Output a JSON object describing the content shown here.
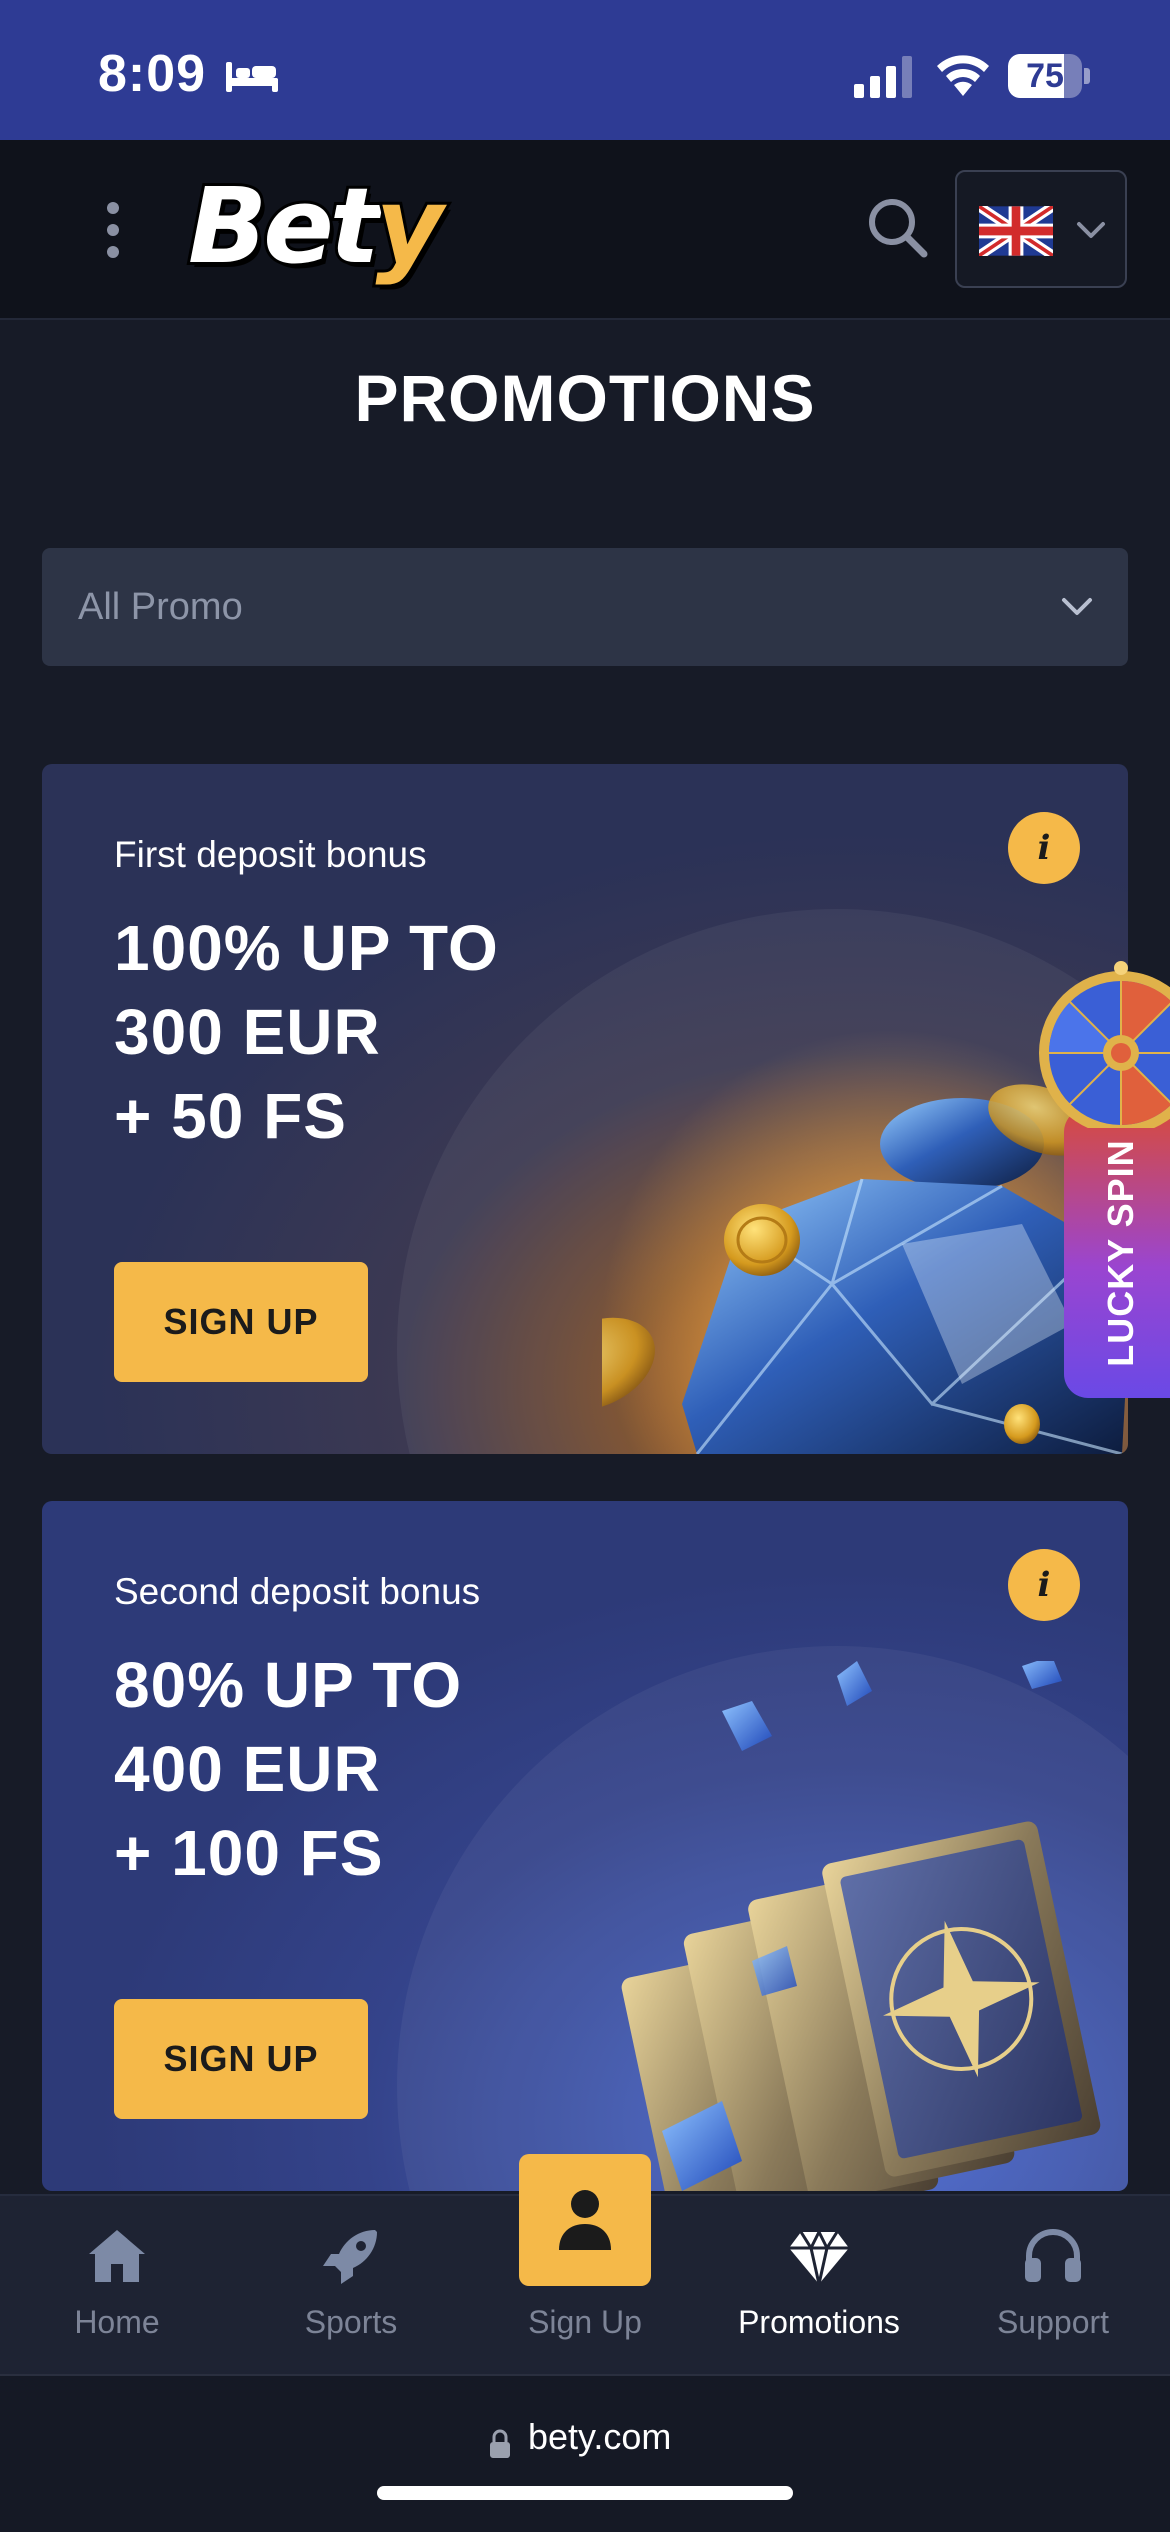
{
  "status_bar": {
    "time": "8:09",
    "battery": "75",
    "battery_level": 0.75
  },
  "header": {
    "logo": {
      "main": "Bet",
      "accent": "y"
    },
    "icons": [
      "menu-dots-icon",
      "search-icon",
      "uk-flag-icon",
      "chevron-down-icon"
    ]
  },
  "page": {
    "title": "PROMOTIONS"
  },
  "filter": {
    "selected": "All Promo"
  },
  "promos": [
    {
      "subtitle": "First deposit bonus",
      "headline": "100% UP TO\n300 EUR\n+ 50 FS",
      "info": "i",
      "cta": "SIGN UP"
    },
    {
      "subtitle": "Second deposit bonus",
      "headline": "80% UP TO\n400 EUR\n+ 100 FS",
      "info": "i",
      "cta": "SIGN UP"
    }
  ],
  "lucky_spin": {
    "label": "LUCKY SPIN"
  },
  "bottom_nav": {
    "items": [
      {
        "label": "Home",
        "icon": "home-icon"
      },
      {
        "label": "Sports",
        "icon": "rocket-icon"
      },
      {
        "label": "Sign Up",
        "icon": "user-icon"
      },
      {
        "label": "Promotions",
        "icon": "diamond-icon",
        "active": true
      },
      {
        "label": "Support",
        "icon": "headphones-icon"
      }
    ]
  },
  "browser": {
    "url": "bety.com"
  },
  "colors": {
    "accent": "#f5b949",
    "status_bar": "#2e3b94",
    "background": "#171b27"
  }
}
